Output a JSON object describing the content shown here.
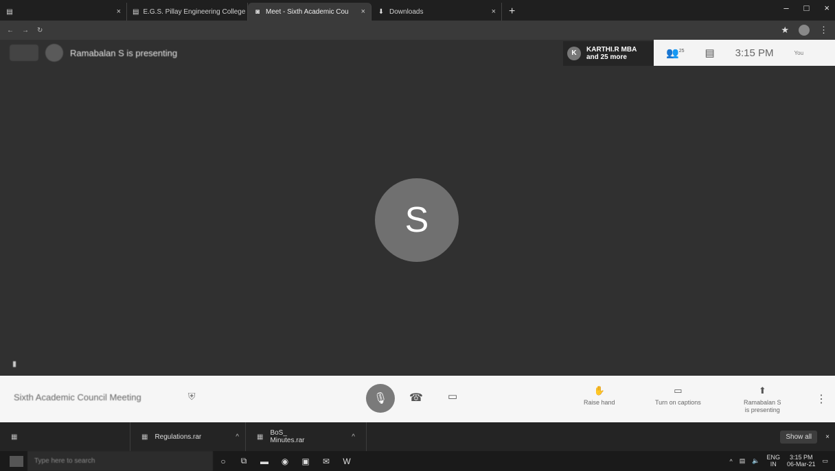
{
  "browser": {
    "tabs": [
      {
        "label": "",
        "icon": "page-icon",
        "active": false
      },
      {
        "label": "E.G.S. Pillay Engineering College",
        "icon": "page-icon",
        "active": false
      },
      {
        "label": "Meet - Sixth Academic Cou",
        "icon": "meet-icon",
        "active": true
      },
      {
        "label": "Downloads",
        "icon": "download-icon",
        "active": false
      }
    ],
    "url": "",
    "window_controls": [
      "–",
      "□",
      "×"
    ]
  },
  "meet": {
    "presenting_text": "Ramabalan S is presenting",
    "participants_chip": {
      "initial": "K",
      "line1": "KARTHI.R MBA",
      "line2": "and 25 more"
    },
    "participants_count_badge": "25",
    "time": "3:15 PM",
    "you_label": "You",
    "main_avatar_initial": "S",
    "bottom_name": "",
    "meeting_title": "Sixth Academic Council Meeting",
    "controls": {
      "raise_hand": "Raise hand",
      "captions": "Turn on captions",
      "presenting_line1": "Ramabalan S",
      "presenting_line2": "is presenting"
    }
  },
  "downloads": {
    "items": [
      {
        "name": "",
        "icon": "file-icon"
      },
      {
        "name": "Regulations.rar",
        "icon": "archive-icon"
      },
      {
        "name": "BoS_ Minutes.rar",
        "icon": "archive-icon"
      }
    ],
    "show_all": "Show all"
  },
  "taskbar": {
    "search_placeholder": "Type here to search",
    "lang": "ENG",
    "region": "IN",
    "time": "3:15 PM",
    "date": "06-Mar-21"
  }
}
